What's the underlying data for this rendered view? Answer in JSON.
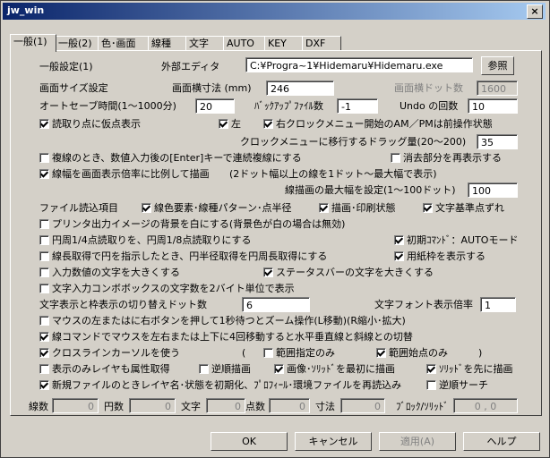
{
  "window": {
    "title": "jw_win",
    "close": "×"
  },
  "tabs": [
    "一般(1)",
    "一般(2)",
    "色･画面",
    "線種",
    "文字",
    "AUTO",
    "KEY",
    "DXF"
  ],
  "panel": {
    "section_title": "一般設定(1)",
    "external_editor_label": "外部エディタ",
    "external_editor_value": "C:¥Progra~1¥Hidemaru¥Hidemaru.exe",
    "browse_label": "参照",
    "screen_size_label": "画面サイズ設定",
    "screen_width_mm_label": "画面横寸法 (mm)",
    "screen_width_mm_value": "246",
    "screen_width_dots_label": "画面横ドット数",
    "screen_width_dots_value": "1600",
    "autosave_label": "オートセーブ時間(1～1000分)",
    "autosave_value": "20",
    "backup_label": "ﾊﾞｯｸｱｯﾌﾟﾌｧｲﾙ数",
    "backup_value": "-1",
    "undo_label": "Undo の回数",
    "undo_value": "10",
    "read_temp_point": "読取り点に仮点表示",
    "left": "左",
    "right_clock_menu": "右クロックメニュー開始のAM／PMは前操作状態",
    "drag_label": "クロックメニューに移行するドラッグ量(20～200)",
    "drag_value": "35",
    "copy_enter": "複線のとき、数値入力後の[Enter]キーで連続複線にする",
    "redisplay_erased": "消去部分を再表示する",
    "line_width_scale": "線幅を画面表示倍率に比例して描画",
    "line_width_scale_note": "(2ドット幅以上の線を1ドット～最大幅で表示)",
    "max_width_label": "線描画の最大幅を設定(1～100ドット)",
    "max_width_value": "100",
    "file_read_label": "ファイル読込項目",
    "line_color_pattern": "線色要素･線種パターン･点半径",
    "drawing_print": "描画･印刷状態",
    "text_base_shift": "文字基準点ずれ",
    "print_bg_white": "プリンタ出力イメージの背景を白にする(背景色が白の場合は無効)",
    "circle_quarter": "円周1/4点読取りを、円周1/8点読取りにする",
    "initial_cmd_auto": "初期ｺﾏﾝﾄﾞ：AUTOモード",
    "line_length_circle": "線長取得で円を指示したとき、円半径取得を円周長取得にする",
    "show_paper_frame": "用紙枠を表示する",
    "enlarge_input_text": "入力数値の文字を大きくする",
    "enlarge_status_text": "ステータスバーの文字を大きくする",
    "combo_2byte": "文字入力コンボボックスの文字数を2バイト単位で表示",
    "frame_switch_label": "文字表示と枠表示の切り替えドット数",
    "frame_switch_value": "6",
    "font_display_scale_label": "文字フォント表示倍率",
    "font_display_scale_value": "1",
    "left_btn_zoom": "マウスの左またはに右ボタンを押して1秒待つとズーム操作(L移動)(R縮小･拡大)",
    "line_cmd_mouse": "線コマンドでマウスを左右または上下に4回移動すると水平垂直線と斜線との切替",
    "crossline_cursor": "クロスラインカーソルを使う",
    "paren_open": "(",
    "range_only": "範囲指定のみ",
    "range_start_only": "範囲始点のみ",
    "paren_close": ")",
    "display_layer_attr": "表示のみレイヤも属性取得",
    "reverse_draw": "逆順描画",
    "image_solid_first": "画像･ｿﾘｯﾄﾞを最初に描画",
    "solid_first": "ｿﾘｯﾄﾞを先に描画",
    "new_file_init": "新規ファイルのときレイヤ名･状態を初期化、ﾌﾟﾛﾌｨｰﾙ･環境ファイルを再読込み",
    "reverse_search": "逆順サーチ",
    "bottom_counts": [
      {
        "label": "線数",
        "value": "0"
      },
      {
        "label": "円数",
        "value": "0"
      },
      {
        "label": "文字",
        "value": "0"
      },
      {
        "label": "点数",
        "value": "0"
      },
      {
        "label": "寸法",
        "value": "0"
      },
      {
        "label": "ﾌﾞﾛｯｸ/ｿﾘｯﾄﾞ",
        "value": "0 , 0"
      }
    ]
  },
  "buttons": {
    "ok": "OK",
    "cancel": "キャンセル",
    "apply": "適用(A)",
    "help": "ヘルプ"
  }
}
